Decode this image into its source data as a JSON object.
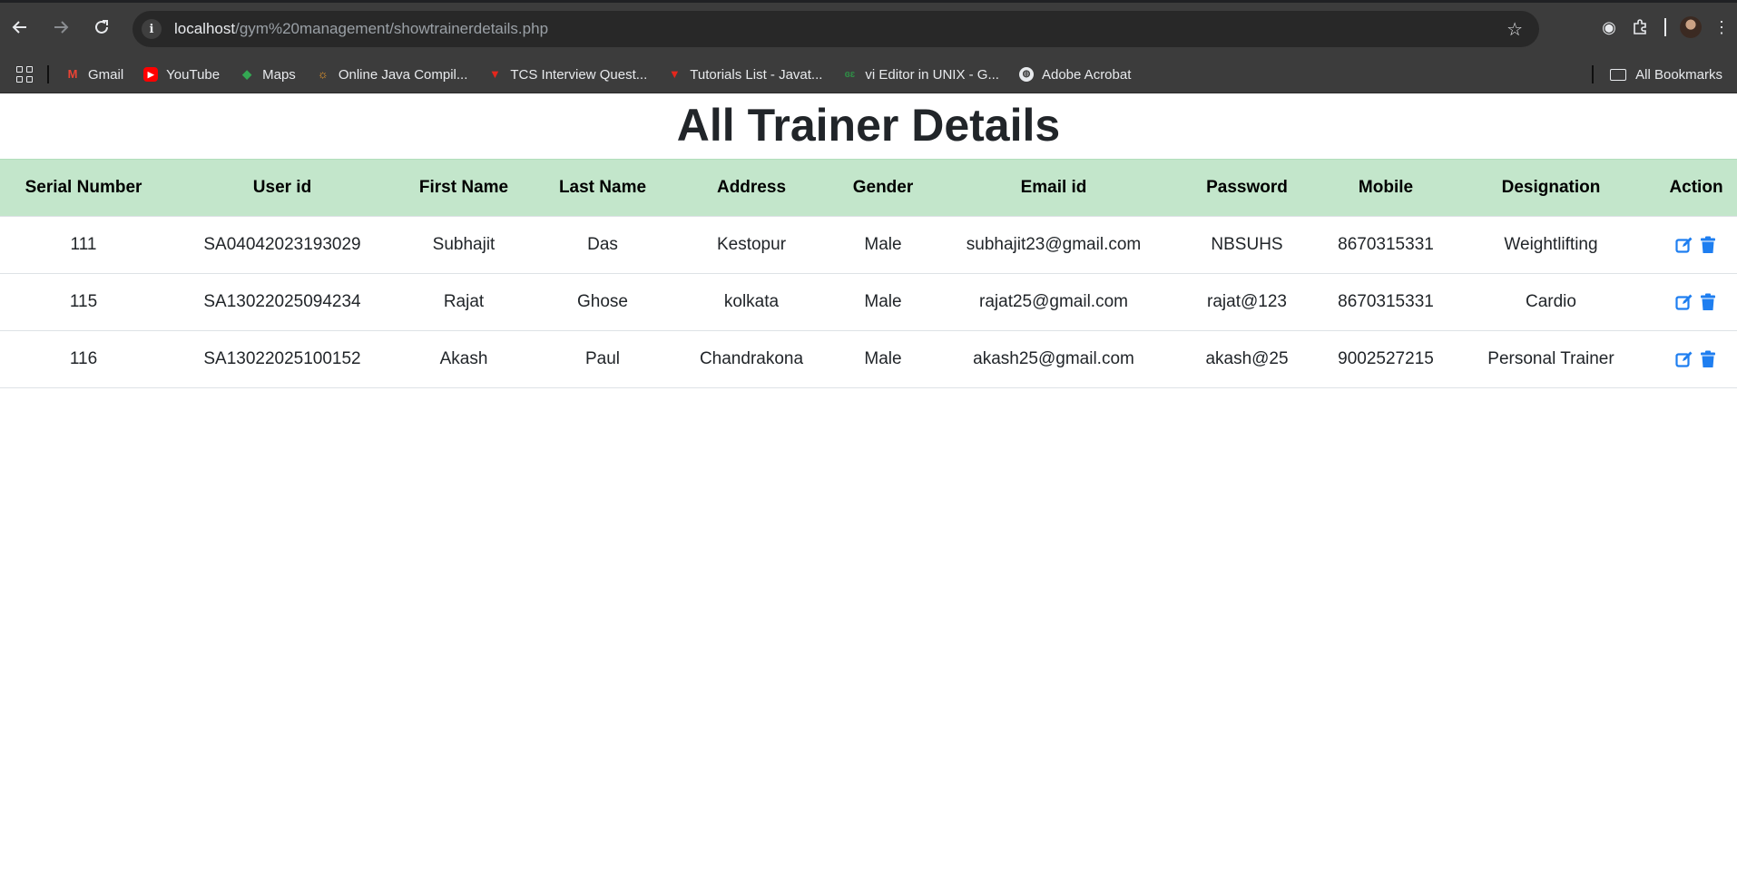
{
  "browser": {
    "url_host": "localhost",
    "url_path": "/gym%20management/showtrainerdetails.php",
    "bookmarks": [
      {
        "label": "Gmail",
        "icon": "gmail-icon"
      },
      {
        "label": "YouTube",
        "icon": "youtube-icon"
      },
      {
        "label": "Maps",
        "icon": "maps-icon"
      },
      {
        "label": "Online Java Compil...",
        "icon": "online-compiler-icon"
      },
      {
        "label": "TCS Interview Quest...",
        "icon": "tcs-icon"
      },
      {
        "label": "Tutorials List - Javat...",
        "icon": "javatpoint-icon"
      },
      {
        "label": "vi Editor in UNIX - G...",
        "icon": "geeksforgeeks-icon"
      },
      {
        "label": "Adobe Acrobat",
        "icon": "globe-icon"
      }
    ],
    "all_bookmarks_label": "All Bookmarks"
  },
  "page": {
    "title": "All Trainer Details"
  },
  "table": {
    "headers": [
      "Serial Number",
      "User id",
      "First Name",
      "Last Name",
      "Address",
      "Gender",
      "Email id",
      "Password",
      "Mobile",
      "Designation",
      "Action"
    ],
    "rows": [
      [
        "111",
        "SA04042023193029",
        "Subhajit",
        "Das",
        "Kestopur",
        "Male",
        "subhajit23@gmail.com",
        "NBSUHS",
        "8670315331",
        "Weightlifting"
      ],
      [
        "115",
        "SA13022025094234",
        "Rajat",
        "Ghose",
        "kolkata",
        "Male",
        "rajat25@gmail.com",
        "rajat@123",
        "8670315331",
        "Cardio"
      ],
      [
        "116",
        "SA13022025100152",
        "Akash",
        "Paul",
        "Chandrakona",
        "Male",
        "akash25@gmail.com",
        "akash@25",
        "9002527215",
        "Personal Trainer"
      ]
    ],
    "action_icons": [
      "edit-icon",
      "delete-icon"
    ]
  },
  "colors": {
    "header_bg": "#c3e6cb",
    "action_blue": "#1e7ef0",
    "chrome_bg": "#3c3c3c"
  }
}
